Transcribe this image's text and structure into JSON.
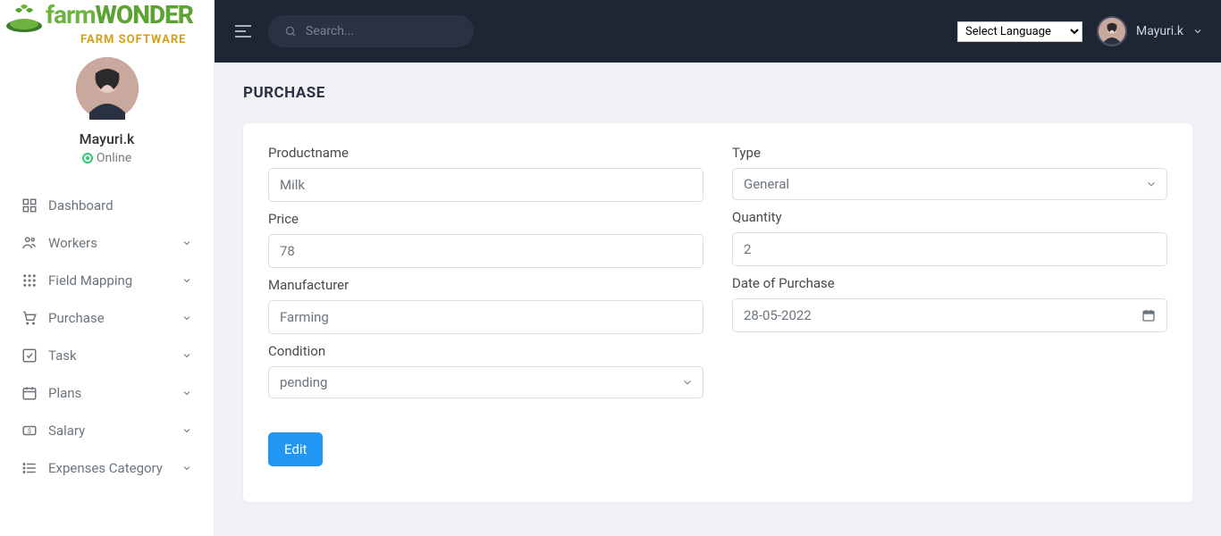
{
  "logo": {
    "part1": "farm",
    "part2": "WONDER",
    "sub": "FARM SOFTWARE"
  },
  "profile": {
    "name": "Mayuri.k",
    "status": "Online"
  },
  "nav": [
    {
      "label": "Dashboard",
      "expandable": false
    },
    {
      "label": "Workers",
      "expandable": true
    },
    {
      "label": "Field Mapping",
      "expandable": true
    },
    {
      "label": "Purchase",
      "expandable": true
    },
    {
      "label": "Task",
      "expandable": true
    },
    {
      "label": "Plans",
      "expandable": true
    },
    {
      "label": "Salary",
      "expandable": true
    },
    {
      "label": "Expenses Category",
      "expandable": true
    }
  ],
  "topbar": {
    "search_placeholder": "Search...",
    "lang_selected": "Select Language",
    "user": "Mayuri.k"
  },
  "page": {
    "title": "PURCHASE"
  },
  "form": {
    "labels": {
      "productname": "Productname",
      "type": "Type",
      "price": "Price",
      "quantity": "Quantity",
      "manufacturer": "Manufacturer",
      "date_of_purchase": "Date of Purchase",
      "condition": "Condition"
    },
    "values": {
      "productname": "Milk",
      "type": "General",
      "price": "78",
      "quantity": "2",
      "manufacturer": "Farming",
      "date_of_purchase": "28-05-2022",
      "condition": "pending"
    },
    "button": "Edit"
  }
}
